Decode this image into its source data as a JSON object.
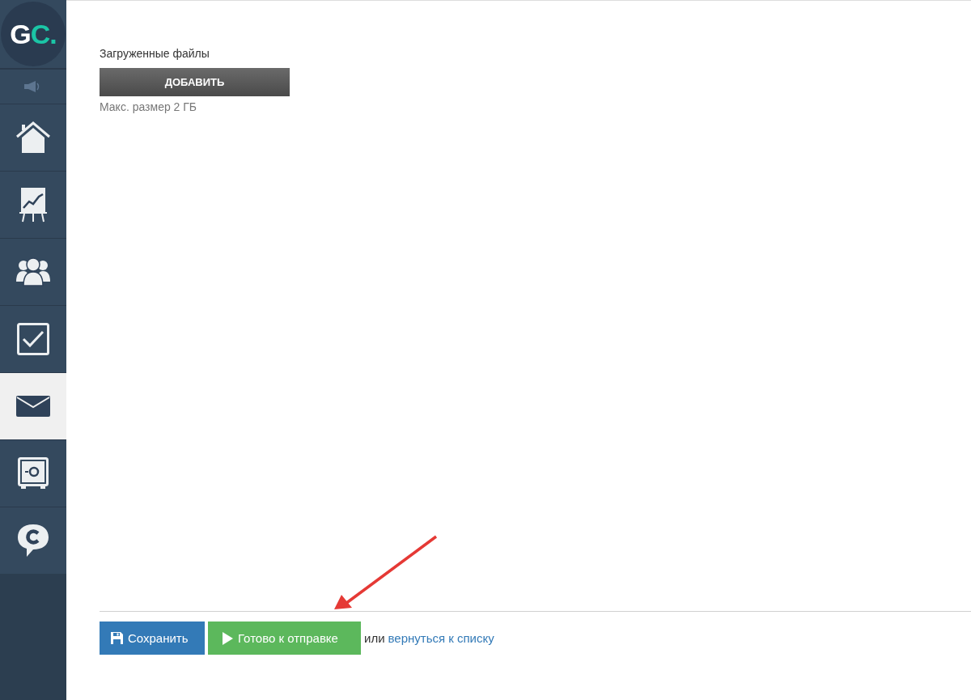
{
  "logo": {
    "main": "G",
    "accent": "C."
  },
  "sidebar": {
    "items": [
      {
        "kind": "speaker",
        "selected": false
      },
      {
        "kind": "home",
        "selected": false
      },
      {
        "kind": "chart",
        "selected": false
      },
      {
        "kind": "people",
        "selected": false
      },
      {
        "kind": "tasks",
        "selected": false
      },
      {
        "kind": "mail",
        "selected": true
      },
      {
        "kind": "safe",
        "selected": false
      },
      {
        "kind": "chat",
        "selected": false
      }
    ]
  },
  "uploads": {
    "label": "Загруженные файлы",
    "button": "ДОБАВИТЬ",
    "hint": "Макс. размер 2 ГБ"
  },
  "footer": {
    "save_button": "Сохранить",
    "ready_button": "Готово к отправке",
    "separator": "или",
    "back_link": "вернуться к списку"
  }
}
